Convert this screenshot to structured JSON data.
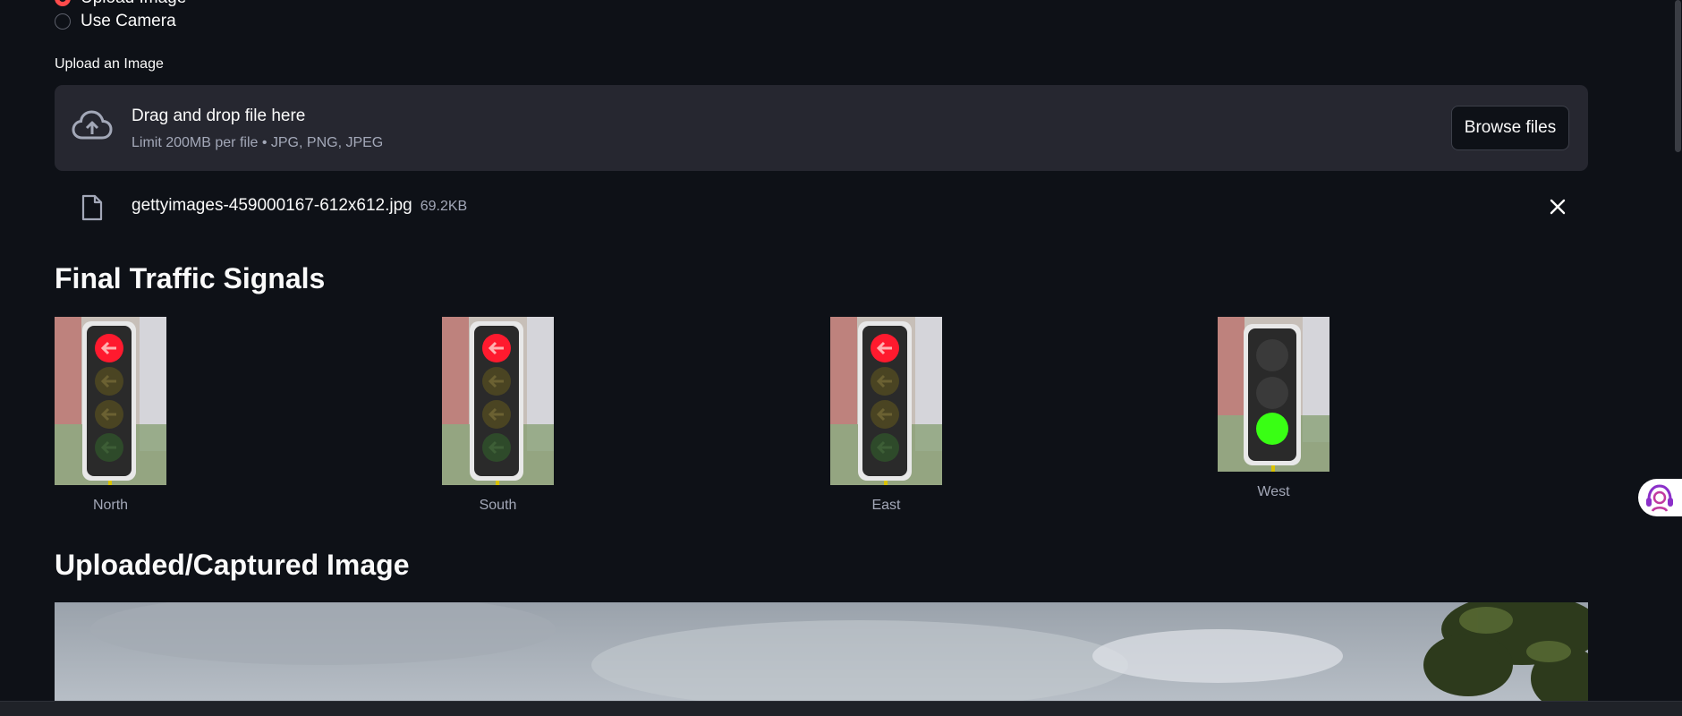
{
  "input_mode": {
    "options": [
      "Upload Image",
      "Use Camera"
    ],
    "selected": "Upload Image"
  },
  "uploader": {
    "label": "Upload an Image",
    "drop_title": "Drag and drop file here",
    "drop_subtitle": "Limit 200MB per file • JPG, PNG, JPEG",
    "browse_label": "Browse files",
    "file": {
      "name": "gettyimages-459000167-612x612.jpg",
      "size": "69.2KB"
    }
  },
  "signals": {
    "heading": "Final Traffic Signals",
    "items": [
      {
        "direction": "North",
        "state": "red"
      },
      {
        "direction": "South",
        "state": "red"
      },
      {
        "direction": "East",
        "state": "red"
      },
      {
        "direction": "West",
        "state": "green"
      }
    ]
  },
  "uploaded": {
    "heading": "Uploaded/Captured Image"
  },
  "colors": {
    "background": "#0e1117",
    "accent": "#ff4b4b",
    "panel": "#262730",
    "muted_text": "#a3a8b8",
    "signal_red": "#ff1a2e",
    "signal_green": "#39ff14"
  }
}
